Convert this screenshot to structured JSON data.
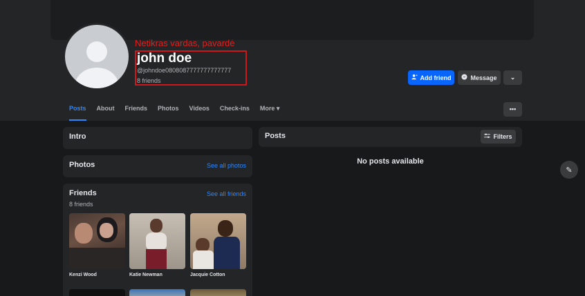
{
  "annotation": "Netikras vardas, pavardė",
  "profile": {
    "name": "john doe",
    "handle": "@johndoe0808087777777777777",
    "friends_count": "8 friends"
  },
  "actions": {
    "add_friend": "Add friend",
    "message": "Message"
  },
  "tabs": [
    {
      "label": "Posts",
      "active": true
    },
    {
      "label": "About"
    },
    {
      "label": "Friends"
    },
    {
      "label": "Photos"
    },
    {
      "label": "Videos"
    },
    {
      "label": "Check-ins"
    },
    {
      "label": "More ▾"
    }
  ],
  "intro": {
    "title": "Intro"
  },
  "photos": {
    "title": "Photos",
    "see_all": "See all photos"
  },
  "friends_card": {
    "title": "Friends",
    "subtitle": "8 friends",
    "see_all": "See all friends",
    "items": [
      {
        "name": "Kenzi Wood"
      },
      {
        "name": "Katie Newman"
      },
      {
        "name": "Jacquie Cotton"
      }
    ]
  },
  "posts": {
    "title": "Posts",
    "filters": "Filters",
    "empty": "No posts available"
  },
  "colors": {
    "accent": "#0866ff",
    "link": "#2d88ff",
    "annotation": "#e41e1e"
  }
}
